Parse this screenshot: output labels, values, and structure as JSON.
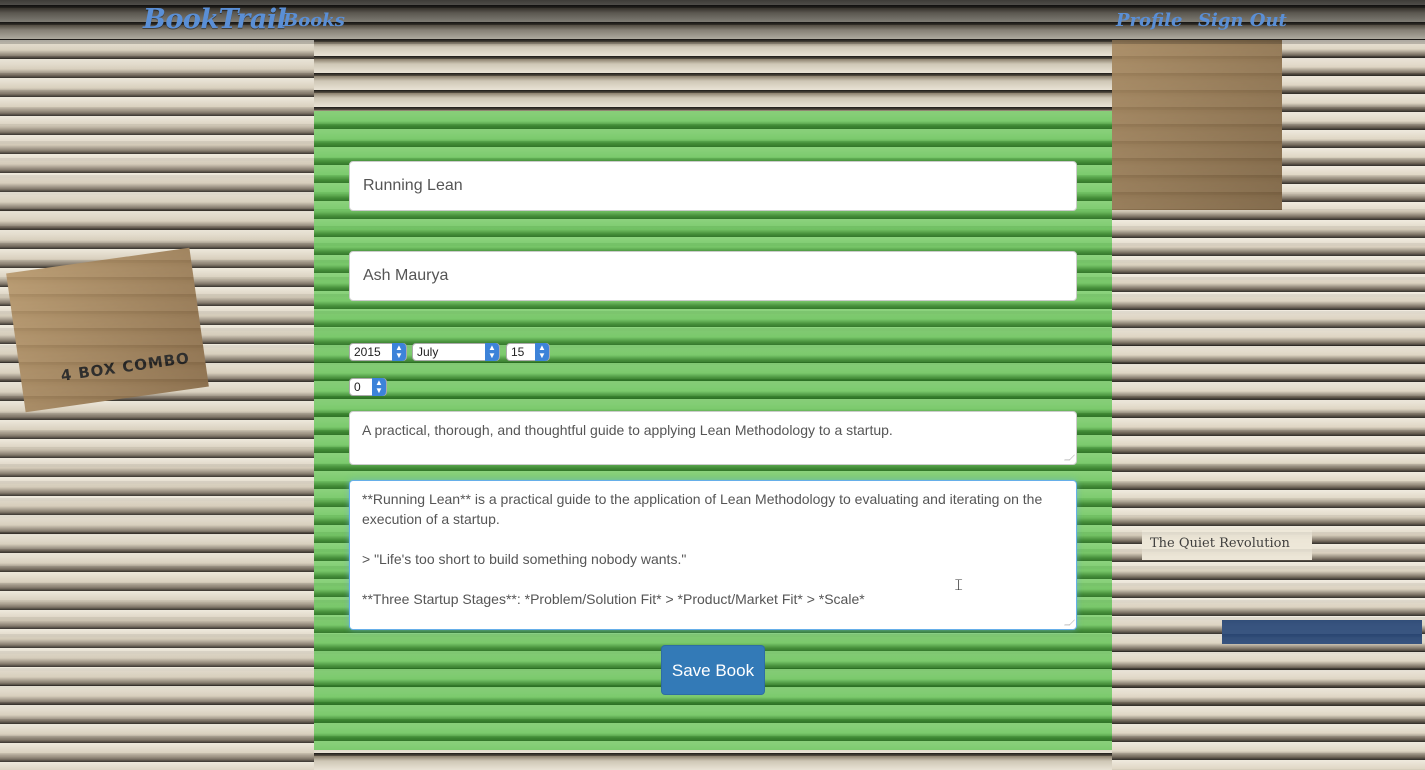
{
  "navbar": {
    "brand": "BookTrail",
    "books_label": "Books",
    "profile_label": "Profile",
    "signout_label": "Sign Out"
  },
  "background": {
    "box_label": "4 BOX COMBO",
    "book_title": "The Quiet Revolution"
  },
  "form": {
    "title_value": "Running Lean",
    "author_value": "Ash Maurya",
    "date": {
      "year": "2015",
      "month": "July",
      "day": "15"
    },
    "rating": "0",
    "summary_value": "A practical, thorough, and thoughtful guide to applying Lean Methodology to a startup.",
    "description_lines": [
      "**Running Lean** is a practical guide to the application of Lean Methodology to evaluating and iterating on the execution of a startup.",
      "",
      "> \"Life's too short to build something nobody wants.\"",
      "",
      "**Three Startup Stages**: *Problem/Solution Fit* > *Product/Market Fit* > *Scale*"
    ],
    "save_label": "Save Book"
  },
  "colors": {
    "nav_link": "#5a8fd6",
    "panel_green": "#4caf3a",
    "button_primary": "#337ab7",
    "focus_blue": "#66afe9"
  }
}
